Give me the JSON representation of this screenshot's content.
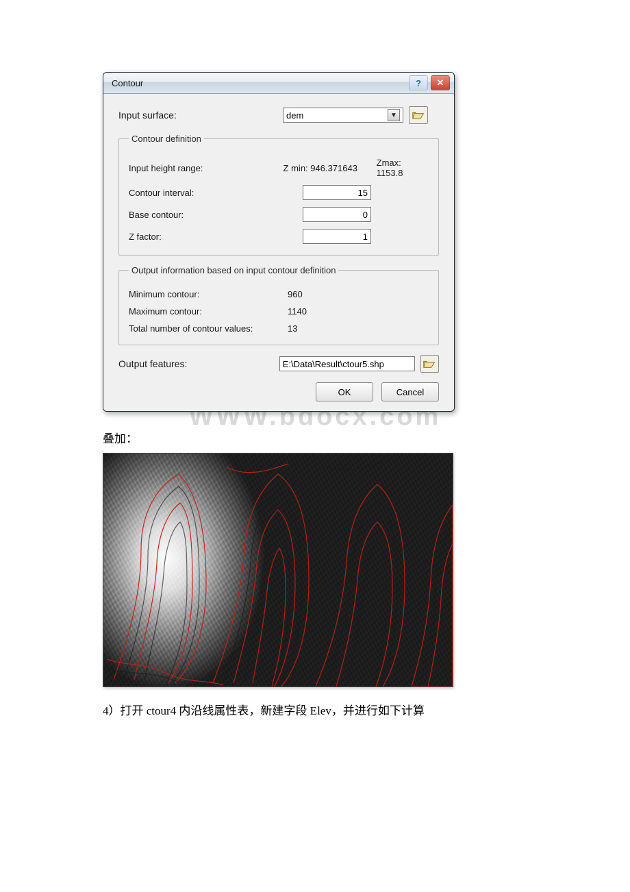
{
  "dialog": {
    "title": "Contour",
    "input_surface_label": "Input surface:",
    "input_surface_value": "dem",
    "fieldset_definition_legend": "Contour definition",
    "height_range_label": "Input height range:",
    "zmin_label": "Z min: 946.371643",
    "zmax_label": "Zmax: 1153.8",
    "contour_interval_label": "Contour interval:",
    "contour_interval_value": "15",
    "base_contour_label": "Base contour:",
    "base_contour_value": "0",
    "z_factor_label": "Z factor:",
    "z_factor_value": "1",
    "fieldset_output_legend": "Output information based on input contour definition",
    "min_contour_label": "Minimum contour:",
    "min_contour_value": "960",
    "max_contour_label": "Maximum contour:",
    "max_contour_value": "1140",
    "total_label": "Total number of contour values:",
    "total_value": "13",
    "output_features_label": "Output features:",
    "output_features_value": "E:\\Data\\Result\\ctour5.shp",
    "ok": "OK",
    "cancel": "Cancel"
  },
  "watermark": "WWW.bdocx.com",
  "text_overlay": "叠加：",
  "text_step4": "4）打开 ctour4 内沿线属性表，新建字段 Elev，并进行如下计算"
}
